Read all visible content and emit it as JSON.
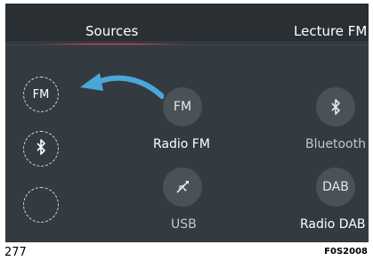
{
  "header": {
    "tabs": [
      {
        "label": "Sources"
      },
      {
        "label": "Lecture FM"
      }
    ]
  },
  "sidebar": {
    "buttons": [
      {
        "label": "FM",
        "icon": "fm-icon"
      },
      {
        "label": "",
        "icon": "bluetooth-icon"
      },
      {
        "label": "",
        "icon": "empty-slot"
      }
    ]
  },
  "sources": [
    {
      "icon_text": "FM",
      "label": "Radio FM",
      "icon": "radio-fm-icon"
    },
    {
      "icon_text": "",
      "label": "Bluetooth",
      "icon": "bluetooth-icon"
    },
    {
      "icon_text": "",
      "label": "USB",
      "icon": "usb-icon"
    },
    {
      "icon_text": "DAB",
      "label": "Radio DAB",
      "icon": "dab-icon"
    }
  ],
  "figure": {
    "number": "277",
    "code": "F0S2008"
  },
  "colors": {
    "accent": "#ff3b5c",
    "arrow": "#4aa8d8",
    "screen_bg": "#333a40"
  }
}
